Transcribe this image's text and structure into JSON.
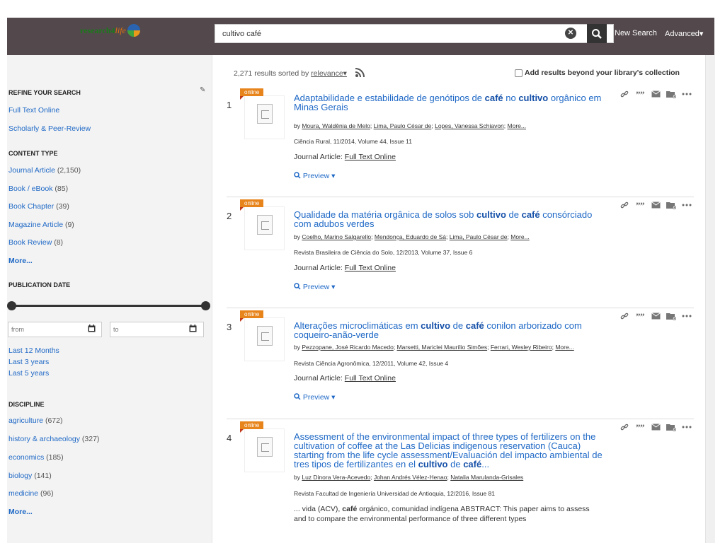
{
  "header": {
    "logo_text_1": "research4",
    "logo_text_2": "life",
    "search_value": "cultivo café",
    "new_search": "New Search",
    "advanced": "Advanced▾"
  },
  "sidebar": {
    "refine": "REFINE YOUR SEARCH",
    "refine_links": [
      "Full Text Online",
      "Scholarly & Peer-Review"
    ],
    "content_type": "CONTENT TYPE",
    "content_items": [
      {
        "label": "Journal Article",
        "count": "(2,150)"
      },
      {
        "label": "Book / eBook",
        "count": "(85)"
      },
      {
        "label": "Book Chapter",
        "count": "(39)"
      },
      {
        "label": "Magazine Article",
        "count": "(9)"
      },
      {
        "label": "Book Review",
        "count": "(8)"
      }
    ],
    "more1": "More...",
    "pub_date": "PUBLICATION DATE",
    "from_placeholder": "from",
    "to_placeholder": "to",
    "year_links": [
      "Last 12 Months",
      "Last 3 years",
      "Last 5 years"
    ],
    "discipline": "DISCIPLINE",
    "discipline_items": [
      {
        "label": "agriculture",
        "count": "(672)"
      },
      {
        "label": "history & archaeology",
        "count": "(327)"
      },
      {
        "label": "economics",
        "count": "(185)"
      },
      {
        "label": "biology",
        "count": "(141)"
      },
      {
        "label": "medicine",
        "count": "(96)"
      }
    ],
    "more2": "More..."
  },
  "main": {
    "count_text": "2,271 results sorted by",
    "sort_label": "relevance▾",
    "beyond_label": "Add results beyond your library's collection",
    "results": [
      {
        "num": "1",
        "badge": "online",
        "title_html": "Adaptabilidade e estabilidade de genótipos de <b>café</b> no <b>cultivo</b> orgânico em Minas Gerais",
        "authors": [
          "Moura, Waldênia de Melo",
          "Lima, Paulo César de",
          "Lopes, Vanessa Schiavon",
          "More..."
        ],
        "source": "Ciência Rural, 11/2014, Volume 44, Issue 11",
        "jtype": "Journal Article:",
        "fulltext": "Full Text Online",
        "preview": "Preview ▾"
      },
      {
        "num": "2",
        "badge": "online",
        "title_html": "Qualidade da matéria orgânica de solos sob <b>cultivo</b> de <b>café</b> consórciado com adubos verdes",
        "authors": [
          "Coelho, Marino Salgarello",
          "Mendonça, Eduardo de Sá",
          "Lima, Paulo César de",
          "More..."
        ],
        "source": "Revista Brasileira de Ciência do Solo, 12/2013, Volume 37, Issue 6",
        "jtype": "Journal Article:",
        "fulltext": "Full Text Online",
        "preview": "Preview ▾"
      },
      {
        "num": "3",
        "badge": "online",
        "title_html": "Alterações microclimáticas em <b>cultivo</b> de <b>café</b> conilon arborizado com coqueiro-anão-verde",
        "authors": [
          "Pezzopane, José Ricardo Macedo",
          "Marsetti, Mariclei Maurílio Simões",
          "Ferrari, Wesley Ribeiro",
          "More..."
        ],
        "source": "Revista Ciência Agronômica, 12/2011, Volume 42, Issue 4",
        "jtype": "Journal Article:",
        "fulltext": "Full Text Online",
        "preview": "Preview ▾"
      },
      {
        "num": "4",
        "badge": "online",
        "title_html": "Assessment of the environmental impact of three types of fertilizers on the cultivation of coffee at the Las Delicias indigenous reservation (Cauca) starting from the life cycle assessment/Evaluación del impacto ambiental de tres tipos de fertilizantes en el <b>cultivo</b> de <b>café</b>...",
        "authors": [
          "Luz Dinora Vera-Acevedo",
          "Johan Andrés Vélez-Henao",
          "Natalia Marulanda-Grisales"
        ],
        "source": "Revista Facultad de Ingeniería Universidad de Antioquia, 12/2016, Issue 81",
        "snippet_html": "... vida (ACV), <b>café</b> orgánico, comunidad indígena ABSTRACT: This paper aims to assess and to compare the environmental performance of three different types"
      }
    ]
  },
  "colors": {
    "header_bg": "#53494c",
    "link": "#1e68c6",
    "badge": "#e7841c"
  }
}
